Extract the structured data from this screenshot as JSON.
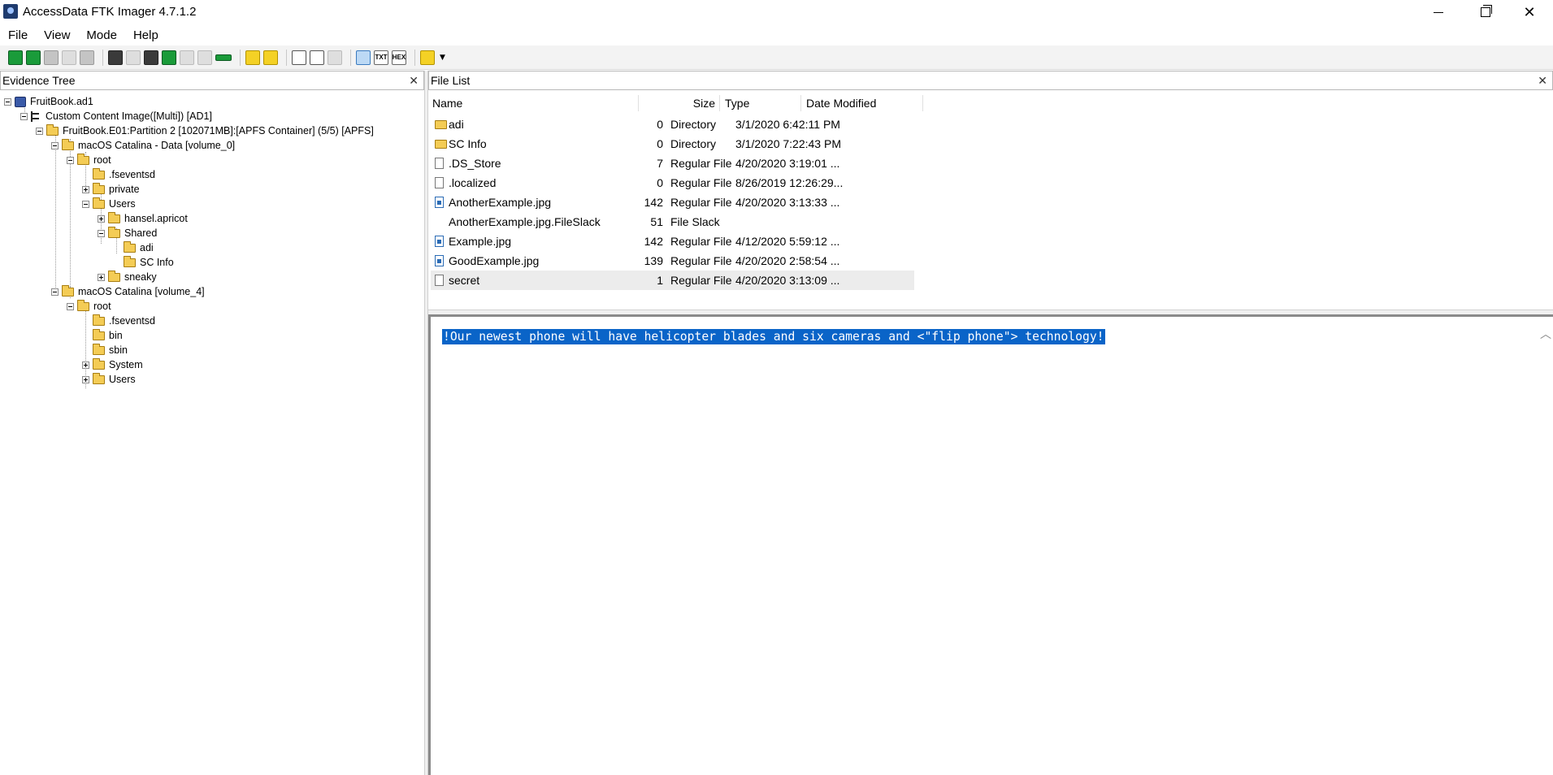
{
  "window": {
    "title": "AccessData FTK Imager 4.7.1.2"
  },
  "menu": {
    "items": [
      "File",
      "View",
      "Mode",
      "Help"
    ]
  },
  "toolbar": {
    "text_view_label": "TXT",
    "hex_view_label": "HEX"
  },
  "evidence_panel": {
    "title": "Evidence Tree",
    "nodes": [
      {
        "label": "FruitBook.ad1"
      },
      {
        "label": "Custom Content Image([Multi]) [AD1]"
      },
      {
        "label": "FruitBook.E01:Partition 2 [102071MB]:[APFS Container] (5/5) [APFS]"
      },
      {
        "label": "macOS Catalina - Data [volume_0]"
      },
      {
        "label": "root"
      },
      {
        "label": ".fseventsd"
      },
      {
        "label": "private"
      },
      {
        "label": "Users"
      },
      {
        "label": "hansel.apricot"
      },
      {
        "label": "Shared"
      },
      {
        "label": "adi"
      },
      {
        "label": "SC Info"
      },
      {
        "label": "sneaky"
      },
      {
        "label": "macOS Catalina [volume_4]"
      },
      {
        "label": "root"
      },
      {
        "label": ".fseventsd"
      },
      {
        "label": "bin"
      },
      {
        "label": "sbin"
      },
      {
        "label": "System"
      },
      {
        "label": "Users"
      }
    ]
  },
  "file_list": {
    "title": "File List",
    "columns": [
      "Name",
      "Size",
      "Type",
      "Date Modified"
    ],
    "rows": [
      {
        "name": "adi",
        "size": "0",
        "type": "Directory",
        "date": "3/1/2020 6:42:11 PM",
        "icon": "folder-icon"
      },
      {
        "name": "SC Info",
        "size": "0",
        "type": "Directory",
        "date": "3/1/2020 7:22:43 PM",
        "icon": "folder-icon"
      },
      {
        "name": ".DS_Store",
        "size": "7",
        "type": "Regular File",
        "date": "4/20/2020 3:19:01 ...",
        "icon": "file-icon"
      },
      {
        "name": ".localized",
        "size": "0",
        "type": "Regular File",
        "date": "8/26/2019 12:26:29...",
        "icon": "file-icon"
      },
      {
        "name": "AnotherExample.jpg",
        "size": "142",
        "type": "Regular File",
        "date": "4/20/2020 3:13:33 ...",
        "icon": "image-file-icon"
      },
      {
        "name": "AnotherExample.jpg.FileSlack",
        "size": "51",
        "type": "File Slack",
        "date": "",
        "icon": "none"
      },
      {
        "name": "Example.jpg",
        "size": "142",
        "type": "Regular File",
        "date": "4/12/2020 5:59:12 ...",
        "icon": "image-file-icon"
      },
      {
        "name": "GoodExample.jpg",
        "size": "139",
        "type": "Regular File",
        "date": "4/20/2020 2:58:54 ...",
        "icon": "image-file-icon"
      },
      {
        "name": "secret",
        "size": "1",
        "type": "Regular File",
        "date": "4/20/2020 3:13:09 ...",
        "icon": "text-file-icon"
      }
    ]
  },
  "viewer": {
    "selected_text": "!Our newest phone will have helicopter blades and six cameras and <\"flip phone\"> technology!"
  },
  "colors": {
    "selection": "#0a64c8",
    "folder": "#f4cc55"
  }
}
